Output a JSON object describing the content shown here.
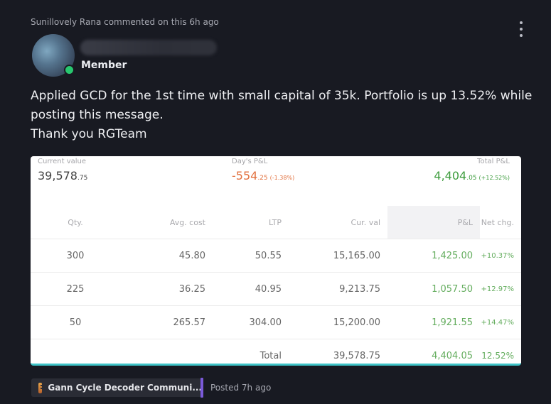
{
  "post": {
    "meta": "Sunillovely Rana commented on this 6h ago",
    "role": "Member",
    "message_lines": [
      "Applied GCD for the 1st time with small capital of 35k. Portfolio is up 13.52% while",
      "posting this message.",
      "Thank you RGTeam"
    ]
  },
  "portfolio": {
    "current_value": {
      "label": "Current value",
      "value": "39,578",
      "decimal": ".75"
    },
    "days_pl": {
      "label": "Day's P&L",
      "value": "-554",
      "decimal": ".25",
      "pct": "(-1.38%)"
    },
    "total_pl": {
      "label": "Total P&L",
      "value": "4,404",
      "decimal": ".05",
      "pct": "(+12.52%)"
    },
    "headers": [
      "Qty.",
      "Avg. cost",
      "LTP",
      "Cur. val",
      "P&L",
      "Net chg."
    ],
    "rows": [
      [
        "300",
        "45.80",
        "50.55",
        "15,165.00",
        "1,425.00",
        "+10.37%"
      ],
      [
        "225",
        "36.25",
        "40.95",
        "9,213.75",
        "1,057.50",
        "+12.97%"
      ],
      [
        "50",
        "265.57",
        "304.00",
        "15,200.00",
        "1,921.55",
        "+14.47%"
      ]
    ],
    "total": {
      "label": "Total",
      "cur_val": "39,578.75",
      "pl": "4,404.05",
      "net": "12.52%"
    }
  },
  "footer": {
    "community": "Gann Cycle Decoder Communi...",
    "posted": "Posted 7h ago"
  },
  "colors": {
    "accent_purple": "#7a5ad9",
    "online_green": "#28c76f",
    "loss": "#e2713f",
    "gain": "#3f9d3f"
  }
}
